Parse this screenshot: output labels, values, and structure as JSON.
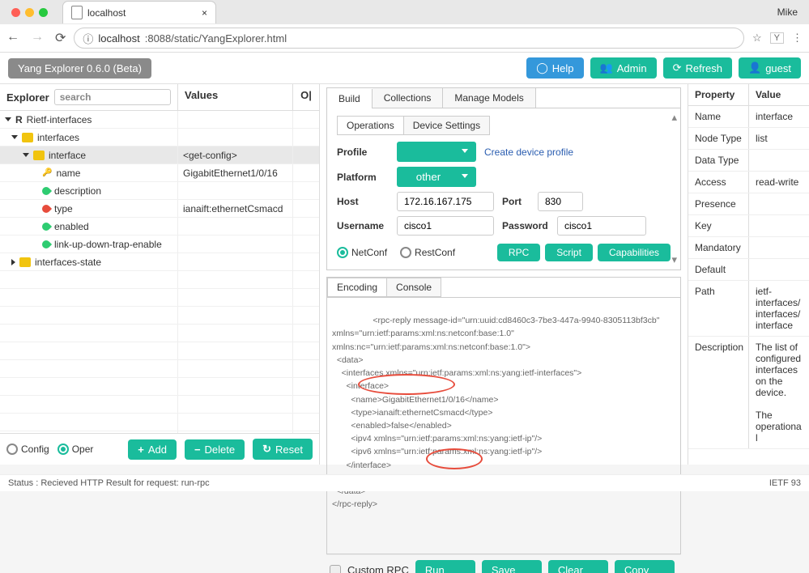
{
  "browser": {
    "tab_label": "localhost",
    "url_prefix": "ⓘ",
    "url_host": "localhost",
    "url_rest": ":8088/static/YangExplorer.html",
    "user": "Mike"
  },
  "toolbar": {
    "brand": "Yang Explorer 0.6.0 (Beta)",
    "help": "Help",
    "admin": "Admin",
    "refresh": "Refresh",
    "guest": "guest"
  },
  "explorer": {
    "title": "Explorer",
    "search_ph": "search",
    "values_title": "Values",
    "op_title": "O|",
    "tree": [
      {
        "l": "Rietf-interfaces",
        "d": 0,
        "ic": "root",
        "tri": "down"
      },
      {
        "l": "interfaces",
        "d": 1,
        "ic": "folder",
        "tri": "down"
      },
      {
        "l": "interface",
        "d": 2,
        "ic": "folder",
        "val": "<get-config>",
        "sel": true,
        "tri": "down"
      },
      {
        "l": "name",
        "d": 3,
        "ic": "key",
        "val": "GigabitEthernet1/0/16"
      },
      {
        "l": "description",
        "d": 3,
        "ic": "leaf"
      },
      {
        "l": "type",
        "d": 3,
        "ic": "leaf-red",
        "val": "ianaift:ethernetCsmacd"
      },
      {
        "l": "enabled",
        "d": 3,
        "ic": "leaf"
      },
      {
        "l": "link-up-down-trap-enable",
        "d": 3,
        "ic": "leaf"
      },
      {
        "l": "interfaces-state",
        "d": 1,
        "ic": "folder",
        "tri": "right"
      }
    ],
    "config": "Config",
    "oper": "Oper",
    "add": "Add",
    "delete": "Delete",
    "reset": "Reset"
  },
  "mid": {
    "top_tabs": [
      "Build",
      "Collections",
      "Manage Models"
    ],
    "sub_tabs": [
      "Operations",
      "Device Settings"
    ],
    "profile": "Profile",
    "create_profile": "Create device profile",
    "platform": "Platform",
    "platform_val": "other",
    "host": "Host",
    "host_val": "172.16.167.175",
    "port": "Port",
    "port_val": "830",
    "user": "Username",
    "user_val": "cisco1",
    "pass": "Password",
    "pass_val": "cisco1",
    "netconf": "NetConf",
    "restconf": "RestConf",
    "rpc": "RPC",
    "script": "Script",
    "caps": "Capabilities",
    "enc_tabs": [
      "Encoding",
      "Console"
    ],
    "xml": "<rpc-reply message-id=\"urn:uuid:cd8460c3-7be3-447a-9940-8305113bf3cb\"\nxmlns=\"urn:ietf:params:xml:ns:netconf:base:1.0\"\nxmlns:nc=\"urn:ietf:params:xml:ns:netconf:base:1.0\">\n  <data>\n    <interfaces xmlns=\"urn:ietf:params:xml:ns:yang:ietf-interfaces\">\n      <interface>\n        <name>GigabitEthernet1/0/16</name>\n        <type>ianaift:ethernetCsmacd</type>\n        <enabled>false</enabled>\n        <ipv4 xmlns=\"urn:ietf:params:xml:ns:yang:ietf-ip\"/>\n        <ipv6 xmlns=\"urn:ietf:params:xml:ns:yang:ietf-ip\"/>\n      </interface>\n    </interfaces>\n  </data>\n</rpc-reply>",
    "custom": "Custom RPC",
    "run": "Run",
    "save": "Save",
    "clear": "Clear",
    "copy": "Copy"
  },
  "props": {
    "h1": "Property",
    "h2": "Value",
    "rows": [
      [
        "Name",
        "interface"
      ],
      [
        "Node Type",
        "list"
      ],
      [
        "Data Type",
        ""
      ],
      [
        "Access",
        "read-write"
      ],
      [
        "Presence",
        ""
      ],
      [
        "Key",
        ""
      ],
      [
        "Mandatory",
        ""
      ],
      [
        "Default",
        ""
      ],
      [
        "Path",
        "ietf-interfaces/interfaces/interface"
      ],
      [
        "Description",
        "The list of configured interfaces on the device.\n\nThe operational"
      ]
    ]
  },
  "status": {
    "text": "Status : Recieved HTTP Result for request: run-rpc",
    "right": "IETF 93"
  }
}
